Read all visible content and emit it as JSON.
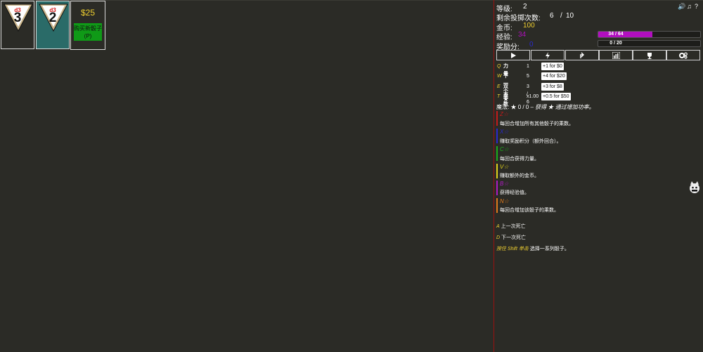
{
  "dice": [
    {
      "type": "d3",
      "face": "3"
    },
    {
      "type": "d3",
      "face": "2"
    }
  ],
  "buy": {
    "price": "$25",
    "label": "购买新骰子 (P)"
  },
  "stats": {
    "level_label": "等级:",
    "level": "2",
    "rolls_label": "剩余投掷次数:",
    "rolls_left": "6",
    "rolls_sep": "/",
    "rolls_total": "10",
    "gold_label": "金币:",
    "gold": "100",
    "exp_label": "经验:",
    "exp": "34",
    "bonus_label": "奖励分:",
    "bonus": "0"
  },
  "exp_bar": {
    "text": "34 / 64",
    "progress": 0.53
  },
  "bonus_bar": {
    "text": "0 / 20",
    "progress": 0.0
  },
  "toolbar": [
    "play-icon",
    "lightning-icon",
    "arrow-up-icon",
    "chart-icon",
    "trophy-icon",
    "gear-icon"
  ],
  "upgrades": [
    {
      "key": "Q",
      "name": "力量",
      "value": "1",
      "button": "+1 for $0"
    },
    {
      "key": "W",
      "name": "下一个 ★",
      "value": "5",
      "button": "+4 for $20"
    },
    {
      "key": "E",
      "name": "双方",
      "value": "3 / 6",
      "button": "+3 for $8"
    },
    {
      "key": "T",
      "name": "乘数",
      "value": "x1.00",
      "button": "+0.5 for $50"
    }
  ],
  "magic": {
    "label": "魔法:",
    "stars": "★ 0 / 0 –",
    "desc": "获得 ★ 通过增加功率。"
  },
  "powers": [
    {
      "key": "Z",
      "star": "☆",
      "desc": "每回合增加所有其他骰子的乘数。",
      "color": "#c41b1b"
    },
    {
      "key": "X",
      "star": "☆",
      "desc": "赚取奖励积分（额外回合）。",
      "color": "#2a2ad0"
    },
    {
      "key": "C",
      "star": "☆",
      "desc": "每回合获得力量。",
      "color": "#1bb01b"
    },
    {
      "key": "V",
      "star": "☆",
      "desc": "赚取额外的金币。",
      "color": "#e0d21b"
    },
    {
      "key": "B",
      "star": "☆",
      "desc": "获得经验值。",
      "color": "#b01bc4"
    },
    {
      "key": "N",
      "star": "☆",
      "desc": "每回合增加该骰子的乘数。",
      "color": "#e07a1b"
    }
  ],
  "hints": [
    {
      "key": "A",
      "text": "上一次死亡"
    },
    {
      "key": "D",
      "text": "下一次死亡"
    },
    {
      "key": "按住 Shift 单击",
      "text": "选择一系列骰子。"
    }
  ],
  "colors": {
    "gold": "#f0d030",
    "exp": "#b10fbf",
    "bonus": "#2a2ad0",
    "divider": "#9a1010"
  }
}
